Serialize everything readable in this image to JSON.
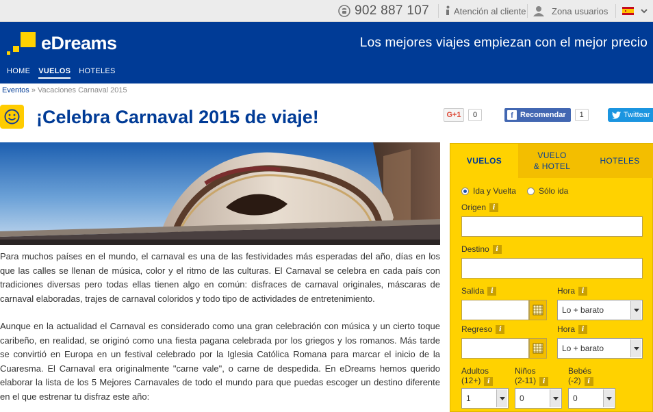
{
  "topbar": {
    "phone": "902 887 107",
    "help": "Atención al cliente",
    "users": "Zona usuarios",
    "language_flag": "spain-flag-icon"
  },
  "header": {
    "logo_text": "eDreams",
    "tagline": "Los mejores viajes empiezan con el mejor precio",
    "nav": [
      {
        "label": "HOME",
        "active": false
      },
      {
        "label": "VUELOS",
        "active": true
      },
      {
        "label": "HOTELES",
        "active": false
      }
    ]
  },
  "breadcrumb": {
    "root": "Eventos",
    "separator": "»",
    "current": "Vacaciones Carnaval 2015"
  },
  "page": {
    "title": "¡Celebra Carnaval 2015 de viaje!"
  },
  "social": {
    "gplus_label": "G+1",
    "gplus_count": "0",
    "fb_label": "Recomendar",
    "fb_count": "1",
    "tw_label": "Twittear"
  },
  "article": {
    "paragraphs": [
      "Para muchos países en el mundo, el carnaval es una de las festividades más esperadas del año, días en los que las calles se llenan de música, color y el ritmo de las culturas. El Carnaval se celebra en cada país con tradiciones diversas pero todas ellas tienen algo en común: disfraces de carnaval originales, máscaras de carnaval elaboradas, trajes de carnaval coloridos y todo tipo de actividades de entretenimiento.",
      "Aunque en la actualidad el Carnaval es considerado como una gran celebración con música y un cierto toque caribeño, en realidad, se originó como una fiesta pagana celebrada por los griegos y los romanos. Más tarde se convirtió en Europa en un festival celebrado por la Iglesia Católica Romana para marcar el inicio de la Cuaresma. El Carnaval era originalmente \"carne vale\", o carne de despedida. En eDreams hemos querido elaborar la lista de los 5 Mejores Carnavales de todo el mundo para que puedas escoger un destino diferente en el que estrenar tu disfraz este año:"
    ]
  },
  "search": {
    "tabs": [
      {
        "label": "VUELOS",
        "active": true
      },
      {
        "label": "VUELO\n& HOTEL",
        "active": false
      },
      {
        "label": "HOTELES",
        "active": false
      }
    ],
    "trip_type": {
      "round_trip": "Ida y Vuelta",
      "one_way": "Sólo ida",
      "selected": "round_trip"
    },
    "origin_label": "Origen",
    "origin_value": "",
    "destination_label": "Destino",
    "destination_value": "",
    "departure_label": "Salida",
    "departure_value": "",
    "departure_time_label": "Hora",
    "departure_time_value": "Lo + barato",
    "return_label": "Regreso",
    "return_value": "",
    "return_time_label": "Hora",
    "return_time_value": "Lo + barato",
    "adults_label_1": "Adultos",
    "adults_label_2": "(12+)",
    "adults_value": "1",
    "children_label_1": "Niños",
    "children_label_2": "(2-11)",
    "children_value": "0",
    "babies_label_1": "Bebés",
    "babies_label_2": "(-2)",
    "babies_value": "0",
    "info_glyph": "i"
  },
  "colors": {
    "brand_blue": "#003b96",
    "brand_yellow": "#ffd200"
  }
}
